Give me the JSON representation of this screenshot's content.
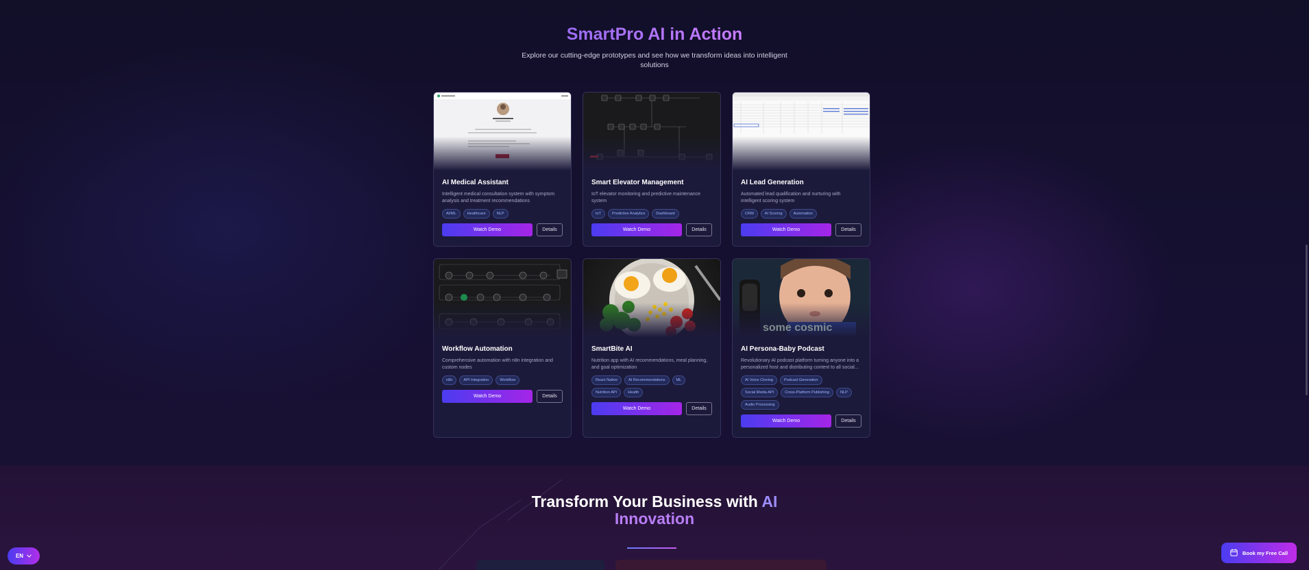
{
  "header": {
    "title": "SmartPro AI in Action",
    "subtitle": "Explore our cutting-edge prototypes and see how we transform ideas into intelligent solutions"
  },
  "cards": [
    {
      "title": "AI Medical Assistant",
      "desc": "Intelligent medical consultation system with symptom analysis and treatment recommendations",
      "tags": [
        "AI/ML",
        "Healthcare",
        "NLP"
      ],
      "demo": "Watch Demo",
      "details": "Details"
    },
    {
      "title": "Smart Elevator Management",
      "desc": "IoT elevator monitoring and predictive maintenance system",
      "tags": [
        "IoT",
        "Predictive Analytics",
        "Dashboard"
      ],
      "demo": "Watch Demo",
      "details": "Details"
    },
    {
      "title": "AI Lead Generation",
      "desc": "Automated lead qualification and nurturing with intelligent scoring system",
      "tags": [
        "CRM",
        "AI Scoring",
        "Automation"
      ],
      "demo": "Watch Demo",
      "details": "Details"
    },
    {
      "title": "Workflow Automation",
      "desc": "Comprehensive automation with n8n integration and custom nodes",
      "tags": [
        "n8n",
        "API Integration",
        "Workflow"
      ],
      "demo": "Watch Demo",
      "details": "Details"
    },
    {
      "title": "SmartBite AI",
      "desc": "Nutrition app with AI recommendations, meal planning, and goal optimization",
      "tags": [
        "React Native",
        "AI Recommendations",
        "ML",
        "Nutrition API",
        "Health"
      ],
      "demo": "Watch Demo",
      "details": "Details"
    },
    {
      "title": "AI Persona-Baby Podcast",
      "desc": "Revolutionary AI podcast platform turning anyone into a personalized host and distributing content to all social...",
      "tags": [
        "AI Voice Cloning",
        "Podcast Generation",
        "Social Media API",
        "Cross-Platform Publishing",
        "NLP",
        "Audio Processing"
      ],
      "demo": "Watch Demo",
      "details": "Details",
      "image_caption": "some cosmic"
    }
  ],
  "cta": {
    "title_part1": "Transform Your Business with ",
    "title_ai": "AI",
    "title_part2": "Innovation"
  },
  "lang": {
    "label": "EN",
    "icon": "chevron-down-icon"
  },
  "book": {
    "label": "Book my Free Call",
    "icon": "calendar-icon"
  }
}
